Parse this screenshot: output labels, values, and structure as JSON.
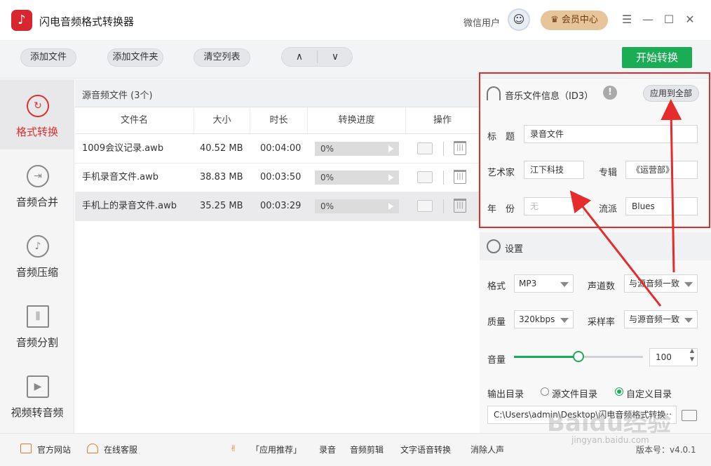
{
  "app": {
    "title": "闪电音频格式转换器",
    "logo_glyph": "♪",
    "user_name": "微信用户",
    "vip_label": "会员中心"
  },
  "window": {
    "menu_glyph": "☰",
    "min_glyph": "—",
    "max_glyph": "☐",
    "close_glyph": "✕"
  },
  "toolbar": {
    "add_file": "添加文件",
    "add_folder": "添加文件夹",
    "clear_list": "清空列表",
    "up_glyph": "∧",
    "down_glyph": "∨",
    "start": "开始转换"
  },
  "nav": [
    {
      "label": "格式转换",
      "icon": "refresh-icon",
      "glyph": "↻"
    },
    {
      "label": "音频合并",
      "icon": "merge-icon",
      "glyph": "⇥"
    },
    {
      "label": "音频压缩",
      "icon": "note-icon",
      "glyph": "♪"
    },
    {
      "label": "音频分割",
      "icon": "split-icon",
      "glyph": "⫼"
    },
    {
      "label": "视频转音频",
      "icon": "play-icon",
      "glyph": "▶"
    }
  ],
  "files": {
    "header": "源音频文件 (3个)",
    "columns": [
      "文件名",
      "大小",
      "时长",
      "转换进度",
      "操作"
    ],
    "rows": [
      {
        "name": "1009会议记录.awb",
        "size": "40.52 MB",
        "duration": "00:04:00",
        "progress": "0%"
      },
      {
        "name": "手机录音文件.awb",
        "size": "38.83 MB",
        "duration": "00:03:50",
        "progress": "0%"
      },
      {
        "name": "手机上的录音文件.awb",
        "size": "35.25 MB",
        "duration": "00:03:29",
        "progress": "0%"
      }
    ],
    "progress_fraction": [
      0,
      0,
      0
    ]
  },
  "id3": {
    "title": "音乐文件信息（ID3）",
    "warn_glyph": "!",
    "apply_all": "应用到全部",
    "title_label": "标　题",
    "title_value": "录音文件",
    "artist_label": "艺术家",
    "artist_value": "江下科技",
    "album_label": "专辑",
    "album_value": "《运营部》",
    "year_label": "年　份",
    "year_value": "无",
    "genre_label": "流派",
    "genre_value": "Blues"
  },
  "settings": {
    "title": "设置",
    "format_label": "格式",
    "format_value": "MP3",
    "channels_label": "声道数",
    "channels_value": "与源音频一致",
    "quality_label": "质量",
    "quality_value": "320kbps",
    "samplerate_label": "采样率",
    "samplerate_value": "与源音频一致",
    "volume_label": "音量",
    "volume_value": "100",
    "volume_fraction": 0.5,
    "spin_up": "▲",
    "spin_down": "▼",
    "output_label": "输出目录",
    "radio_source": "源文件目录",
    "radio_custom": "自定义目录",
    "output_path": "C:\\Users\\admin\\Desktop\\闪电音频格式转换",
    "more_glyph": "···"
  },
  "footer": {
    "website": "官方网站",
    "support": "在线客服",
    "recommend": "「应用推荐」",
    "record": "录音",
    "edit": "音频剪辑",
    "tts": "文字语音转换",
    "vocal": "消除人声",
    "version": "版本号：v4.0.1"
  },
  "watermark": {
    "big": "Baidu经验",
    "small": "jingyan.baidu.com"
  },
  "colors": {
    "accent_green": "#1aad55",
    "active_red": "#e0312f",
    "annotation_red": "#e62b2b",
    "vip_gold": "#e8c49a"
  }
}
